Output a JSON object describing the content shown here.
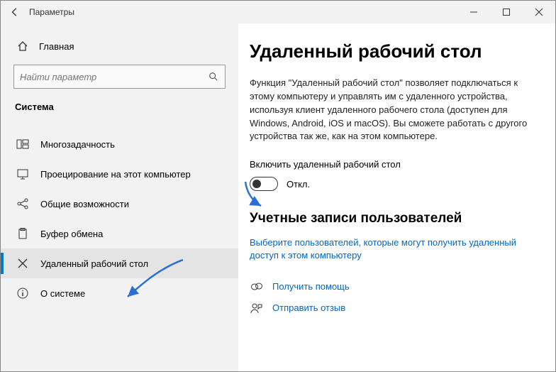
{
  "window": {
    "title": "Параметры"
  },
  "sidebar": {
    "home_label": "Главная",
    "search_placeholder": "Найти параметр",
    "category": "Система",
    "items": [
      {
        "label": "Многозадачность"
      },
      {
        "label": "Проецирование на этот компьютер"
      },
      {
        "label": "Общие возможности"
      },
      {
        "label": "Буфер обмена"
      },
      {
        "label": "Удаленный рабочий стол"
      },
      {
        "label": "О системе"
      }
    ]
  },
  "main": {
    "heading": "Удаленный рабочий стол",
    "description": "Функция \"Удаленный рабочий стол\" позволяет подключаться к этому компьютеру и управлять им с удаленного устройства, используя клиент удаленного рабочего стола (доступен для Windows, Android, iOS и macOS). Вы сможете работать с другого устройства так же, как на этом компьютере.",
    "toggle_label": "Включить удаленный рабочий стол",
    "toggle_state": "Откл.",
    "accounts_heading": "Учетные записи пользователей",
    "accounts_link": "Выберите пользователей, которые могут получить удаленный доступ к этом компьютеру",
    "help_label": "Получить помощь",
    "feedback_label": "Отправить отзыв"
  }
}
